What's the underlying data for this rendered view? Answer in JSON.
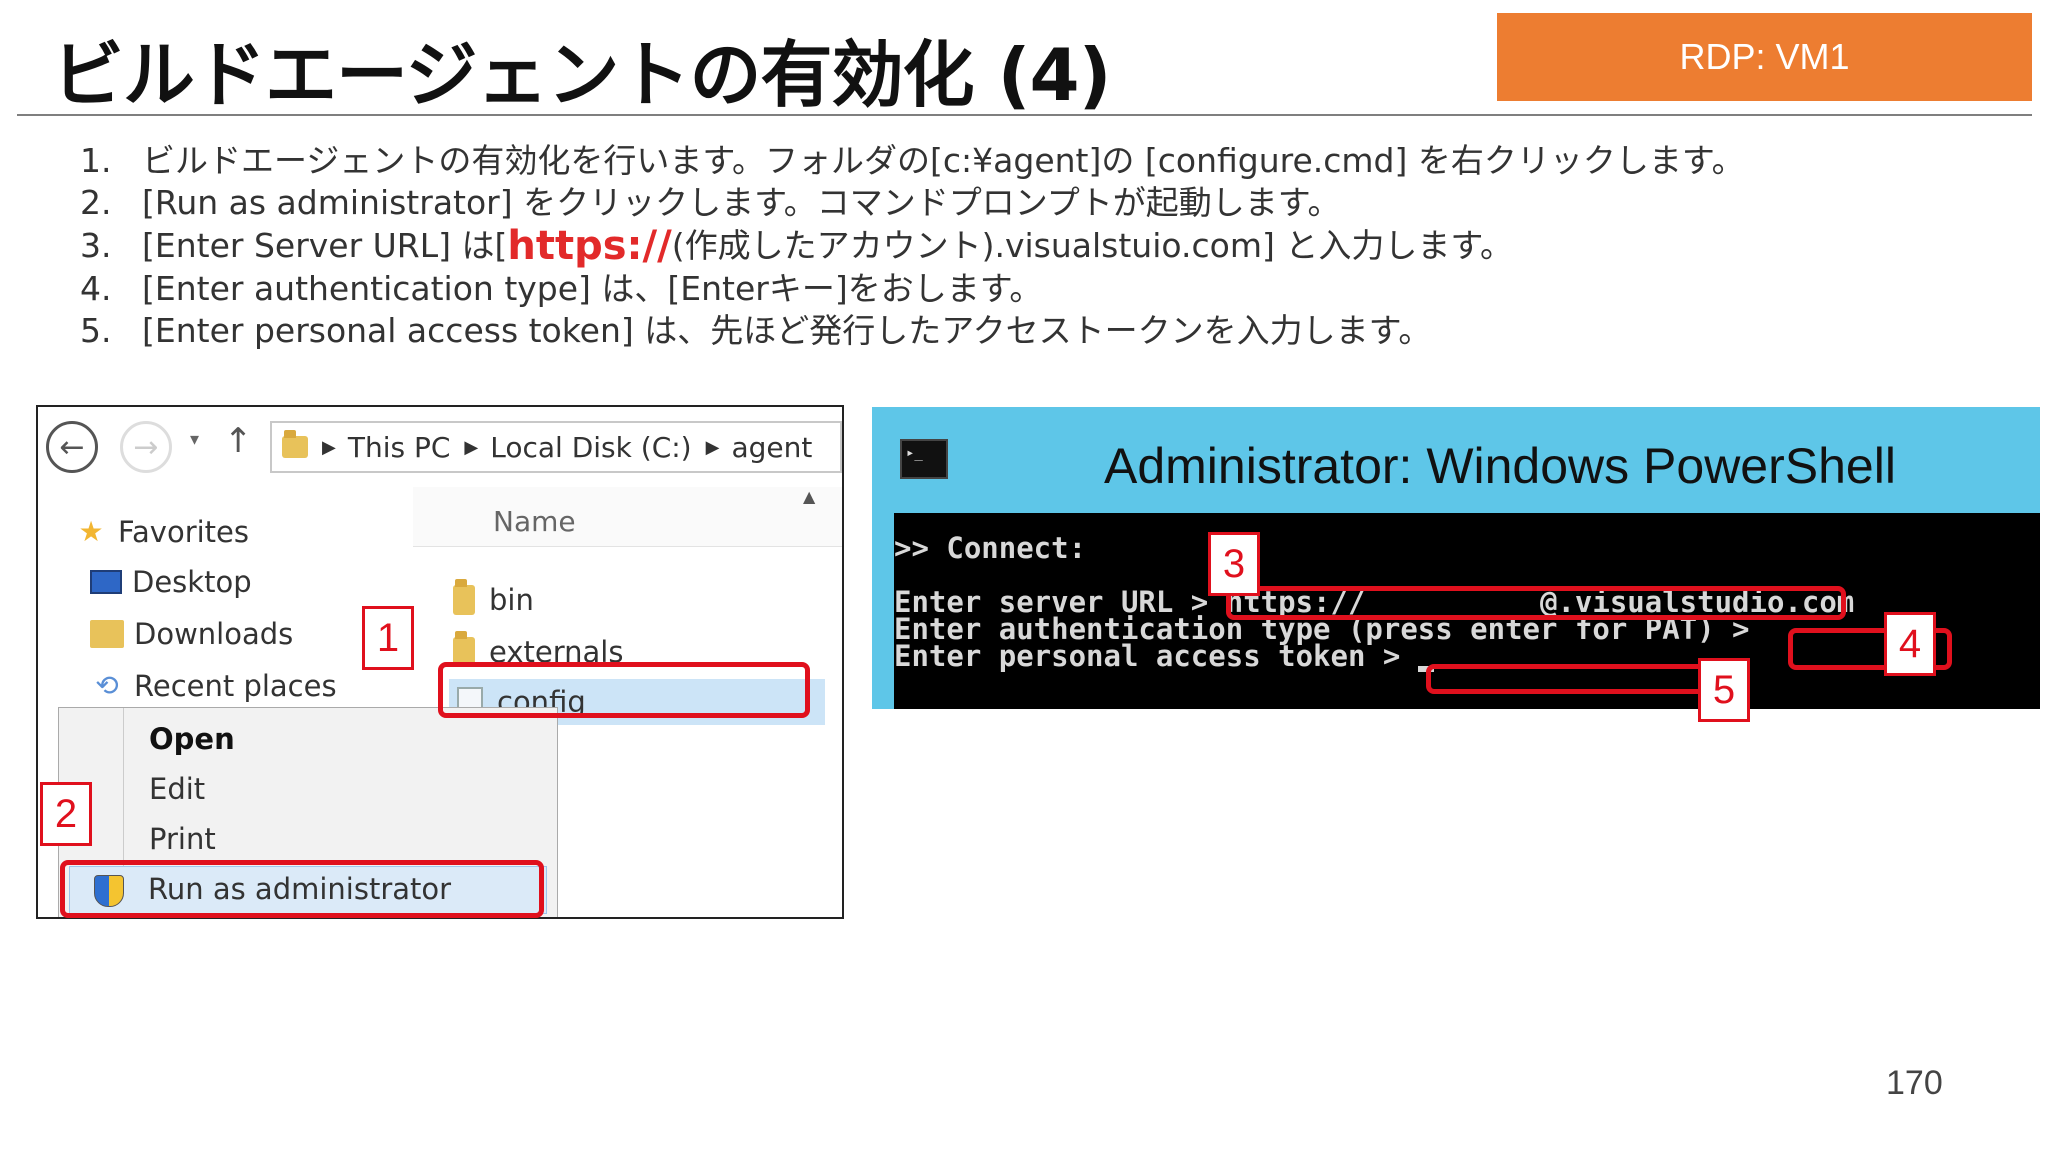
{
  "header": {
    "title": "ビルドエージェントの有効化 (4)",
    "badge": "RDP: VM1"
  },
  "steps": [
    {
      "num": "1.",
      "text": "ビルドエージェントの有効化を行います。フォルダの[c:¥agent]の [configure.cmd] を右クリックします。"
    },
    {
      "num": "2.",
      "text": "[Run as administrator] をクリックします。コマンドプロンプトが起動します。"
    },
    {
      "num": "3.",
      "pre": "[Enter Server URL] は[",
      "highlight": "https://",
      "post": "(作成したアカウント).visualstuio.com] と入力します。"
    },
    {
      "num": "4.",
      "text": "[Enter authentication type] は、[Enterキー]をおします。"
    },
    {
      "num": "5.",
      "text": "[Enter personal access token] は、先ほど発行したアクセストークンを入力します。"
    }
  ],
  "explorer": {
    "breadcrumb": [
      "This PC",
      "Local Disk (C:)",
      "agent"
    ],
    "nav": [
      "Favorites",
      "Desktop",
      "Downloads",
      "Recent places"
    ],
    "column_header": "Name",
    "files": [
      "bin",
      "externals",
      "config"
    ],
    "context_menu": [
      "Open",
      "Edit",
      "Print",
      "Run as administrator"
    ]
  },
  "powershell": {
    "title": "Administrator: Windows PowerShell",
    "icon_text": "▸_",
    "lines": [
      ">> Connect:",
      "",
      "Enter server URL > https://          @.visualstudio.com",
      "Enter authentication type (press enter for PAT) >",
      "Enter personal access token > "
    ]
  },
  "callouts": [
    "1",
    "2",
    "3",
    "4",
    "5"
  ],
  "page_number": "170",
  "colors": {
    "badge": "#ed7d31",
    "callout": "#e0101d",
    "ps_title_bar": "#5ec6e8"
  }
}
